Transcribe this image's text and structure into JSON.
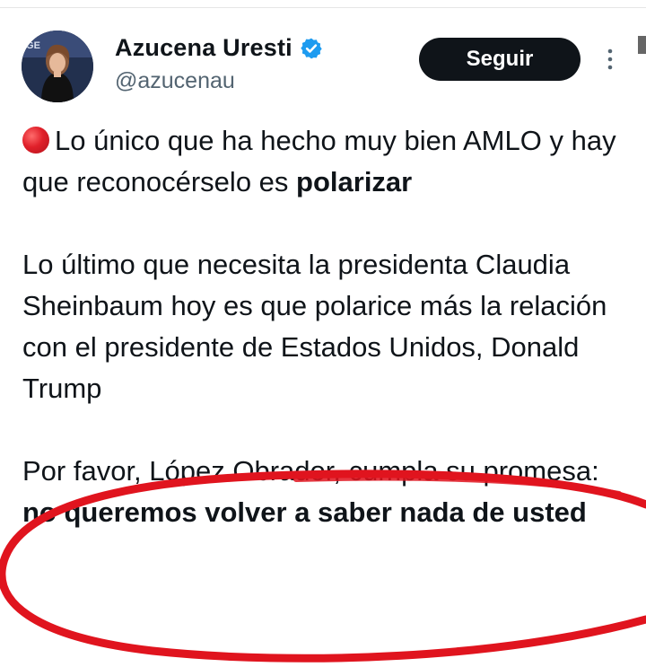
{
  "author": {
    "display_name": "Azucena Uresti",
    "handle": "@azucenau",
    "verified": true,
    "avatar_icon": "profile-photo"
  },
  "actions": {
    "follow_label": "Seguir",
    "more_icon": "vertical-ellipsis-icon"
  },
  "tweet": {
    "p1_emoji": "red-circle-icon",
    "p1_text": "Lo único que ha hecho muy bien AMLO y hay que reconocérselo es ",
    "p1_bold": "polarizar",
    "p2_text": "Lo último que necesita la presidenta Claudia Sheinbaum hoy es que polarice más la relación con el presidente de Estados Unidos, Donald Trump",
    "p3_text": "Por favor, López Obrador, cumpla su promesa: ",
    "p3_bold": "no queremos volver a saber nada de usted"
  },
  "colors": {
    "verified": "#1d9bf0",
    "handle": "#536471",
    "button_bg": "#0f1419",
    "highlight": "#e0141e"
  }
}
